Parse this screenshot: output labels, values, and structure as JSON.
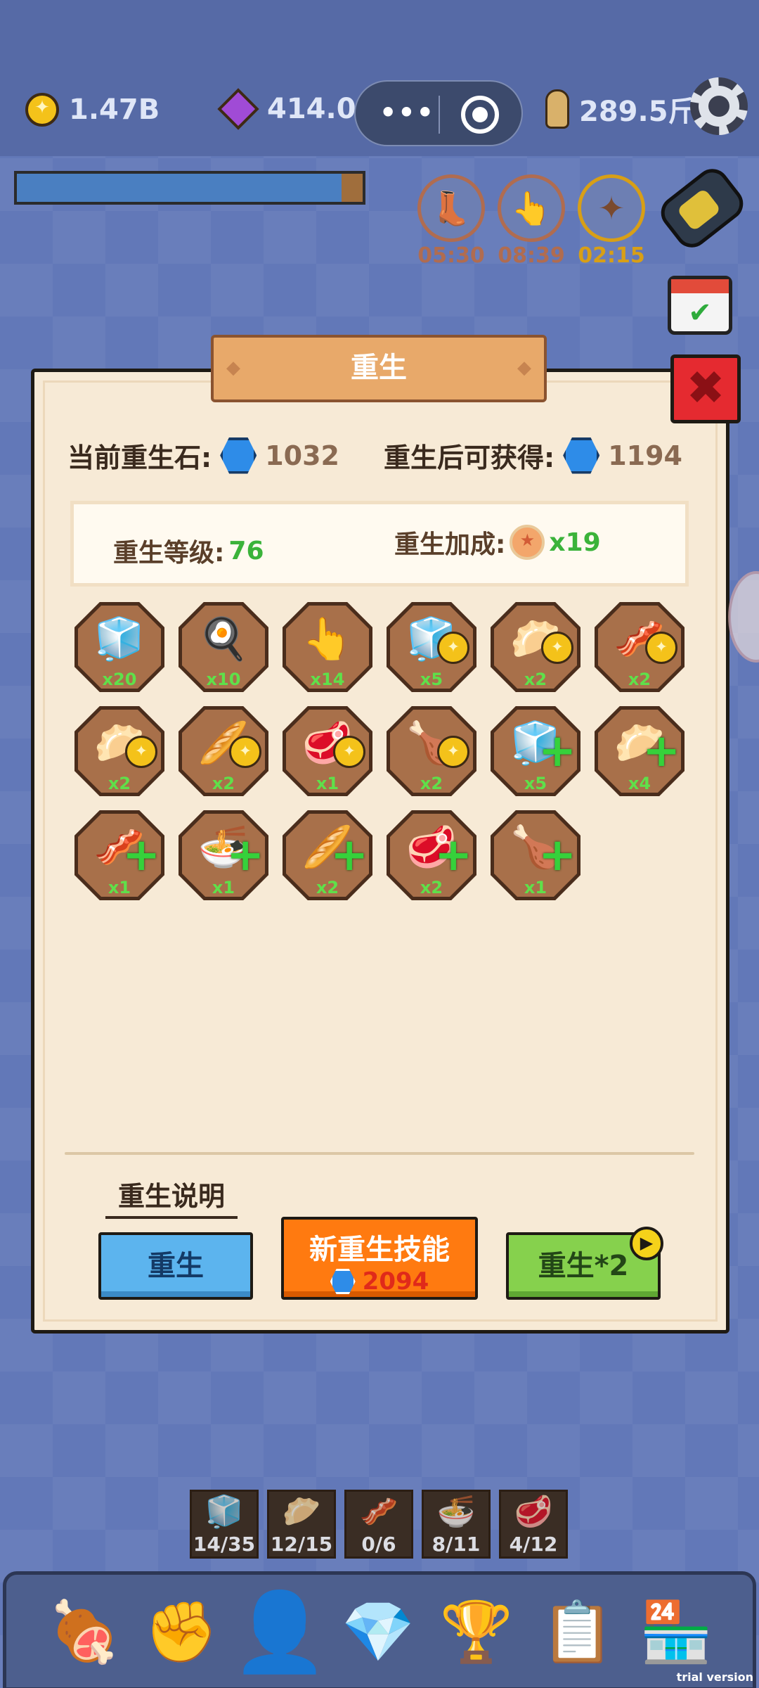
{
  "top_bar": {
    "coins": "1.47B",
    "gems": "414.0",
    "weight": "289.5斤"
  },
  "progress": {
    "fraction": 0.94
  },
  "timers": [
    {
      "name": "boot-timer",
      "icon": "boot-icon",
      "glyph": "👢",
      "time": "05:30"
    },
    {
      "name": "hand-timer",
      "icon": "hand-icon",
      "glyph": "👆",
      "time": "08:39"
    },
    {
      "name": "coin-timer",
      "icon": "coin-icon",
      "glyph": "✦",
      "time": "02:15"
    }
  ],
  "panel": {
    "title": "重生",
    "current_stone_label": "当前重生石:",
    "current_stone_value": "1032",
    "after_gain_label": "重生后可获得:",
    "after_gain_value": "1194",
    "level_label": "重生等级:",
    "level_value": "76",
    "bonus_label": "重生加成:",
    "bonus_value": "x19",
    "explain_label": "重生说明"
  },
  "rewards": [
    {
      "icon": "meat-cubes-icon",
      "glyph": "🧊",
      "badge": "none",
      "count": "x20"
    },
    {
      "icon": "spatula-icon",
      "glyph": "🍳",
      "badge": "none",
      "count": "x10"
    },
    {
      "icon": "tap-hand-icon",
      "glyph": "👆",
      "badge": "none",
      "count": "x14"
    },
    {
      "icon": "meat-cubes-icon",
      "glyph": "🧊",
      "badge": "coin",
      "count": "x5"
    },
    {
      "icon": "bun-icon",
      "glyph": "🥟",
      "badge": "coin",
      "count": "x2"
    },
    {
      "icon": "tongue-icon",
      "glyph": "🥓",
      "badge": "coin",
      "count": "x2"
    },
    {
      "icon": "dumpling-icon",
      "glyph": "🥟",
      "badge": "coin",
      "count": "x2"
    },
    {
      "icon": "fried-dough-icon",
      "glyph": "🥖",
      "badge": "coin",
      "count": "x2"
    },
    {
      "icon": "pork-belly-icon",
      "glyph": "🥩",
      "badge": "coin",
      "count": "x1"
    },
    {
      "icon": "roast-chicken-icon",
      "glyph": "🍗",
      "badge": "coin",
      "count": "x2"
    },
    {
      "icon": "meat-cubes-icon",
      "glyph": "🧊",
      "badge": "plus",
      "count": "x5"
    },
    {
      "icon": "bun-icon",
      "glyph": "🥟",
      "badge": "plus",
      "count": "x4"
    },
    {
      "icon": "tongue-icon",
      "glyph": "🥓",
      "badge": "plus",
      "count": "x1"
    },
    {
      "icon": "noodle-bowl-icon",
      "glyph": "🍜",
      "badge": "plus",
      "count": "x1"
    },
    {
      "icon": "fried-dough-icon",
      "glyph": "🥖",
      "badge": "plus",
      "count": "x2"
    },
    {
      "icon": "pork-belly-icon",
      "glyph": "🥩",
      "badge": "plus",
      "count": "x2"
    },
    {
      "icon": "roast-chicken-icon",
      "glyph": "🍗",
      "badge": "plus",
      "count": "x1"
    }
  ],
  "buttons": {
    "rebirth": "重生",
    "new_skill": "新重生技能",
    "new_skill_cost": "2094",
    "rebirth_double": "重生*2"
  },
  "inventory": [
    {
      "icon": "meat-cubes-icon",
      "glyph": "🧊",
      "count": "14/35"
    },
    {
      "icon": "bun-icon",
      "glyph": "🥟",
      "count": "12/15"
    },
    {
      "icon": "tongue-icon",
      "glyph": "🥓",
      "count": "0/6"
    },
    {
      "icon": "noodle-bowl-icon",
      "glyph": "🍜",
      "count": "8/11"
    },
    {
      "icon": "pork-belly-icon",
      "glyph": "🥩",
      "count": "4/12"
    }
  ],
  "nav": [
    {
      "name": "nav-meat",
      "icon": "ham-icon",
      "glyph": "🍖"
    },
    {
      "name": "nav-fist",
      "icon": "fist-icon",
      "glyph": "✊"
    },
    {
      "name": "nav-avatar",
      "icon": "avatar-icon",
      "glyph": "👤"
    },
    {
      "name": "nav-gem",
      "icon": "gem-icon",
      "glyph": "💎"
    },
    {
      "name": "nav-trophy",
      "icon": "trophy-icon",
      "glyph": "🏆"
    },
    {
      "name": "nav-tasks",
      "icon": "clipboard-icon",
      "glyph": "📋"
    },
    {
      "name": "nav-shop",
      "icon": "shop-icon",
      "glyph": "🏪"
    }
  ],
  "watermark": "trial version"
}
